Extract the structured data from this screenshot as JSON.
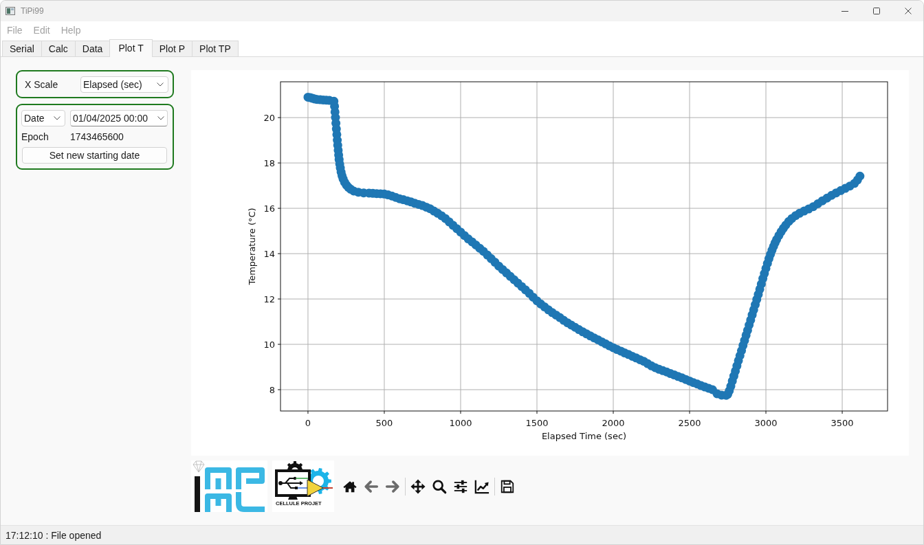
{
  "window": {
    "title": "TiPi99"
  },
  "menu": [
    "File",
    "Edit",
    "Help"
  ],
  "tabs": [
    {
      "label": "Serial",
      "selected": false
    },
    {
      "label": "Calc",
      "selected": false
    },
    {
      "label": "Data",
      "selected": false
    },
    {
      "label": "Plot T",
      "selected": true
    },
    {
      "label": "Plot P",
      "selected": false
    },
    {
      "label": "Plot TP",
      "selected": false
    }
  ],
  "x_scale": {
    "label": "X Scale",
    "value": "Elapsed (sec)"
  },
  "start_date": {
    "mode": "Date",
    "datetime": "01/04/2025 00:00",
    "epoch_label": "Epoch",
    "epoch": "1743465600",
    "button": "Set new starting date"
  },
  "plot": {
    "chart_data": {
      "type": "scatter",
      "xlabel": "Elapsed Time (sec)",
      "ylabel": "Temperature (°C)",
      "x": [
        0,
        15,
        30,
        45,
        60,
        80,
        100,
        120,
        140,
        170,
        174,
        177,
        180,
        183,
        186,
        189,
        192,
        195,
        198,
        201,
        204,
        208,
        212,
        217,
        223,
        230,
        240,
        252,
        265,
        280,
        300,
        330,
        365,
        400,
        425,
        450,
        475,
        500,
        525,
        550,
        575,
        600,
        625,
        650,
        675,
        700,
        725,
        750,
        775,
        800,
        825,
        850,
        875,
        900,
        925,
        950,
        975,
        1000,
        1025,
        1050,
        1075,
        1100,
        1125,
        1150,
        1175,
        1200,
        1225,
        1250,
        1275,
        1300,
        1325,
        1350,
        1375,
        1400,
        1425,
        1450,
        1475,
        1500,
        1525,
        1550,
        1575,
        1600,
        1625,
        1650,
        1675,
        1700,
        1725,
        1750,
        1775,
        1800,
        1825,
        1850,
        1875,
        1900,
        1925,
        1950,
        1975,
        2000,
        2025,
        2050,
        2075,
        2100,
        2125,
        2150,
        2175,
        2200,
        2225,
        2250,
        2275,
        2300,
        2325,
        2350,
        2375,
        2400,
        2425,
        2450,
        2475,
        2500,
        2525,
        2550,
        2575,
        2600,
        2625,
        2650,
        2680,
        2710,
        2740,
        2750,
        2760,
        2770,
        2780,
        2790,
        2800,
        2810,
        2820,
        2830,
        2840,
        2850,
        2860,
        2870,
        2880,
        2890,
        2900,
        2910,
        2920,
        2930,
        2940,
        2950,
        2960,
        2970,
        2980,
        2990,
        3000,
        3010,
        3020,
        3030,
        3040,
        3050,
        3060,
        3070,
        3085,
        3100,
        3115,
        3130,
        3150,
        3170,
        3195,
        3220,
        3250,
        3280,
        3310,
        3340,
        3370,
        3400,
        3430,
        3460,
        3490,
        3520,
        3550,
        3580,
        3600,
        3616
      ],
      "series": [
        {
          "color": "#1f77b4",
          "values": [
            20.9,
            20.88,
            20.85,
            20.82,
            20.8,
            20.79,
            20.78,
            20.77,
            20.76,
            20.72,
            20.5,
            20.25,
            20.0,
            19.75,
            19.5,
            19.25,
            19.0,
            18.78,
            18.56,
            18.35,
            18.15,
            17.95,
            17.78,
            17.6,
            17.44,
            17.3,
            17.15,
            17.02,
            16.92,
            16.84,
            16.76,
            16.71,
            16.68,
            16.67,
            16.66,
            16.65,
            16.64,
            16.63,
            16.59,
            16.54,
            16.48,
            16.42,
            16.38,
            16.33,
            16.28,
            16.22,
            16.17,
            16.12,
            16.05,
            15.98,
            15.88,
            15.78,
            15.67,
            15.55,
            15.4,
            15.25,
            15.1,
            14.95,
            14.8,
            14.65,
            14.52,
            14.38,
            14.24,
            14.1,
            13.94,
            13.78,
            13.62,
            13.45,
            13.3,
            13.15,
            13.0,
            12.85,
            12.7,
            12.55,
            12.4,
            12.25,
            12.08,
            11.92,
            11.78,
            11.65,
            11.52,
            11.4,
            11.29,
            11.18,
            11.06,
            10.95,
            10.85,
            10.75,
            10.65,
            10.55,
            10.46,
            10.37,
            10.28,
            10.2,
            10.11,
            10.02,
            9.93,
            9.85,
            9.77,
            9.7,
            9.62,
            9.55,
            9.47,
            9.4,
            9.32,
            9.25,
            9.15,
            9.05,
            8.97,
            8.9,
            8.84,
            8.78,
            8.71,
            8.65,
            8.58,
            8.52,
            8.45,
            8.38,
            8.31,
            8.25,
            8.18,
            8.12,
            8.06,
            8.0,
            7.82,
            7.76,
            7.75,
            7.8,
            7.95,
            8.15,
            8.38,
            8.6,
            8.82,
            9.05,
            9.28,
            9.5,
            9.72,
            9.95,
            10.17,
            10.4,
            10.62,
            10.85,
            11.07,
            11.3,
            11.52,
            11.75,
            11.98,
            12.2,
            12.43,
            12.66,
            12.9,
            13.12,
            13.35,
            13.57,
            13.78,
            13.97,
            14.15,
            14.32,
            14.48,
            14.62,
            14.8,
            14.97,
            15.12,
            15.26,
            15.42,
            15.55,
            15.68,
            15.78,
            15.88,
            15.97,
            16.07,
            16.2,
            16.33,
            16.45,
            16.57,
            16.68,
            16.78,
            16.88,
            16.98,
            17.1,
            17.25,
            17.42
          ]
        }
      ],
      "xlim": [
        -180,
        3797
      ],
      "ylim": [
        7.06,
        21.58
      ],
      "xticks": [
        0,
        500,
        1000,
        1500,
        2000,
        2500,
        3000,
        3500
      ],
      "yticks": [
        8,
        10,
        12,
        14,
        16,
        18,
        20
      ],
      "grid": true
    }
  },
  "logo": {
    "caption": "CELLULE PROJET"
  },
  "status_bar": {
    "message": "17:12:10 : File opened"
  }
}
